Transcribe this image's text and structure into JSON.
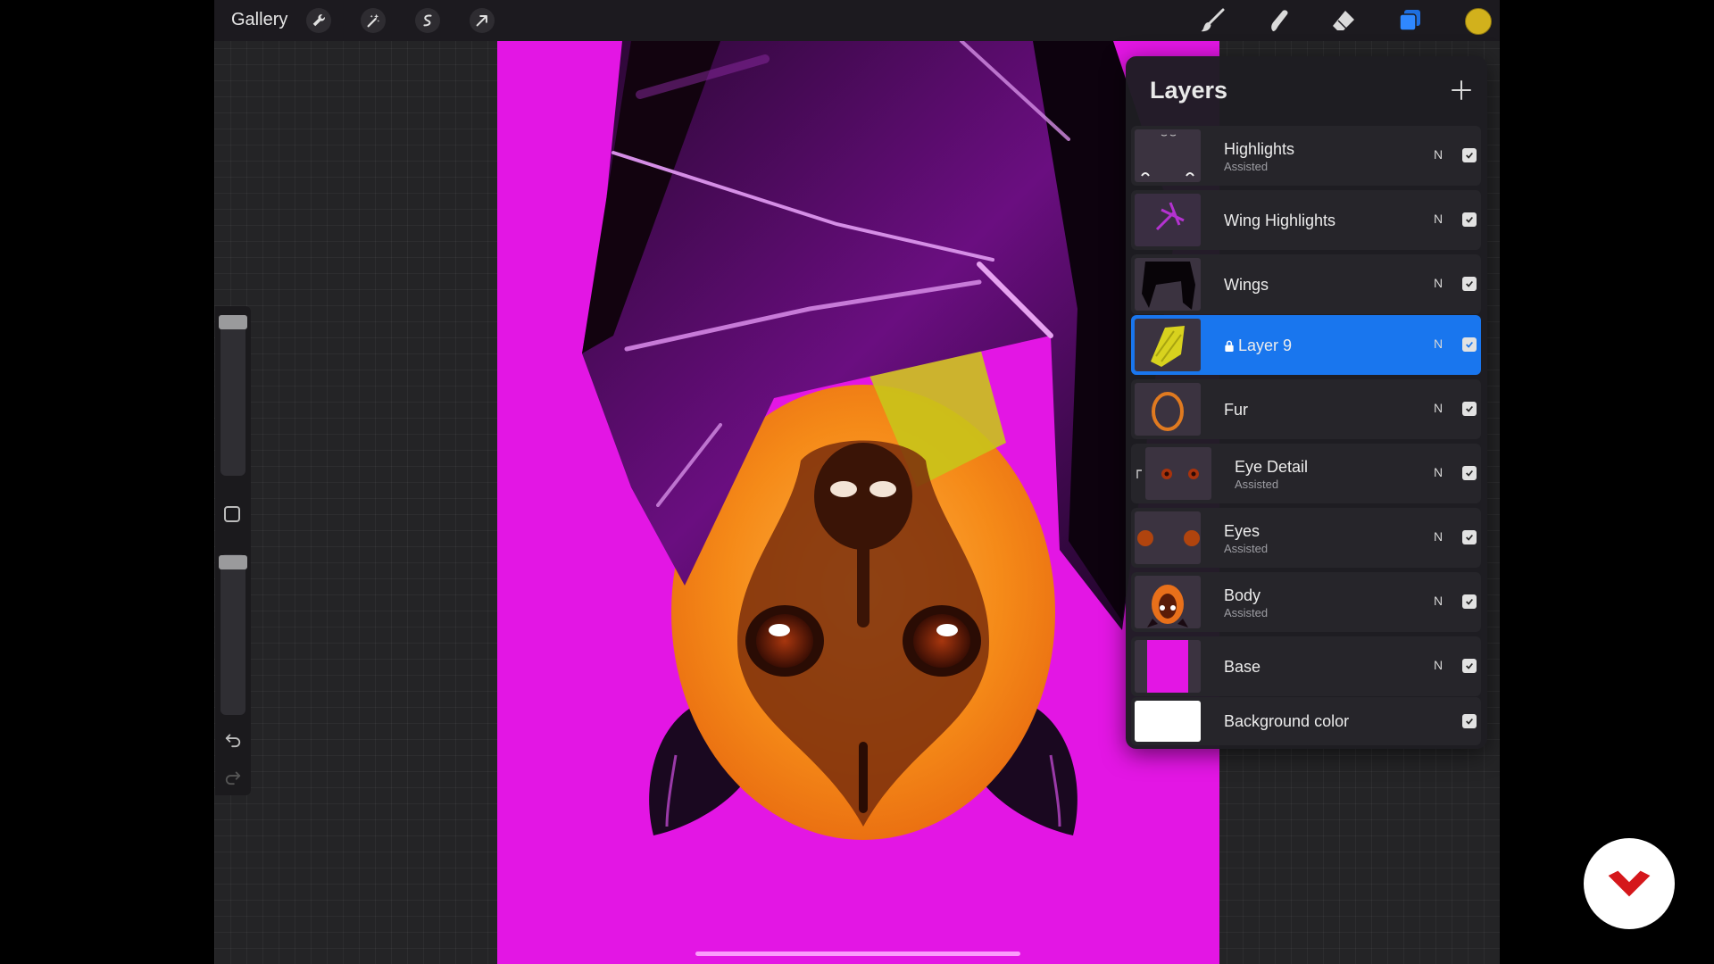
{
  "toolbar": {
    "gallery_label": "Gallery",
    "icons": [
      "wrench-icon",
      "magic-wand-icon",
      "selection-icon",
      "transform-arrow-icon",
      "brush-icon",
      "smudge-icon",
      "eraser-icon",
      "layers-icon"
    ],
    "current_color": "#d2b11c"
  },
  "sidebar": {
    "icons": [
      "brush-size-slider",
      "modify-square-icon",
      "opacity-slider",
      "undo-icon",
      "redo-icon"
    ]
  },
  "canvas": {
    "background_color": "#e316e4",
    "subject": "upside-down bat illustration"
  },
  "layers_panel": {
    "title": "Layers",
    "layers": [
      {
        "name": "Highlights",
        "subtitle": "Assisted",
        "blend": "N",
        "visible": true,
        "selected": false
      },
      {
        "name": "Wing Highlights",
        "subtitle": "",
        "blend": "N",
        "visible": true,
        "selected": false
      },
      {
        "name": "Wings",
        "subtitle": "",
        "blend": "N",
        "visible": true,
        "selected": false
      },
      {
        "name": "Layer 9",
        "subtitle": "",
        "blend": "N",
        "visible": true,
        "selected": true,
        "locked": true
      },
      {
        "name": "Fur",
        "subtitle": "",
        "blend": "N",
        "visible": true,
        "selected": false
      },
      {
        "name": "Eye Detail",
        "subtitle": "Assisted",
        "blend": "N",
        "visible": true,
        "selected": false,
        "clipped": true
      },
      {
        "name": "Eyes",
        "subtitle": "Assisted",
        "blend": "N",
        "visible": true,
        "selected": false
      },
      {
        "name": "Body",
        "subtitle": "Assisted",
        "blend": "N",
        "visible": true,
        "selected": false
      },
      {
        "name": "Base",
        "subtitle": "",
        "blend": "N",
        "visible": true,
        "selected": false
      }
    ],
    "background_layer": {
      "name": "Background color",
      "visible": true
    }
  },
  "colors": {
    "selection_blue": "#1976ee",
    "canvas_magenta": "#e316e4",
    "bat_orange": "#f28a1c",
    "wing_purple": "#7a1090",
    "badge_red": "#d5171b"
  }
}
